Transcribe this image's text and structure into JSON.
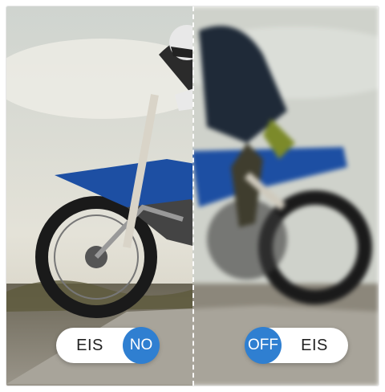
{
  "left_toggle": {
    "label": "EIS",
    "state": "NO"
  },
  "right_toggle": {
    "label": "EIS",
    "state": "OFF"
  },
  "colors": {
    "badge": "#2f7fd1",
    "pill": "#ffffff",
    "bike": "#1d4fa3"
  }
}
